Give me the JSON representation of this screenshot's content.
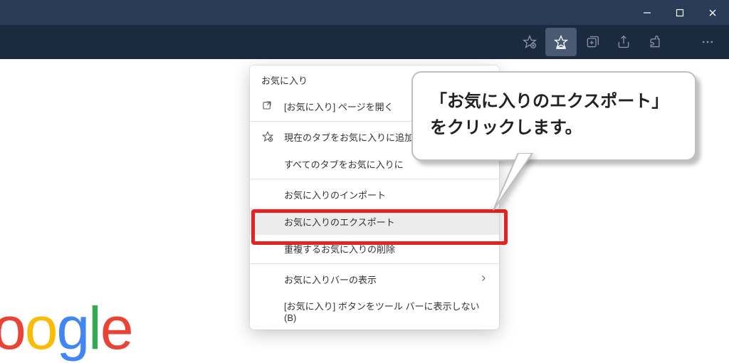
{
  "dropdown": {
    "title": "お気に入り",
    "open_page": "[お気に入り] ページを開く",
    "add_current": "現在のタブをお気に入りに追加",
    "add_all": "すべてのタブをお気に入りに",
    "import": "お気に入りのインポート",
    "export": "お気に入りのエクスポート",
    "remove_dup": "重複するお気に入りの削除",
    "bar_show": "お気に入りバーの表示",
    "hide_button": "[お気に入り] ボタンをツール バーに表示しない(B)"
  },
  "callout": {
    "text": "「お気に入りのエクスポート」をクリックします。"
  },
  "logo": {
    "o1": "o",
    "o2": "o",
    "g": "g",
    "l": "l",
    "e": "e"
  }
}
